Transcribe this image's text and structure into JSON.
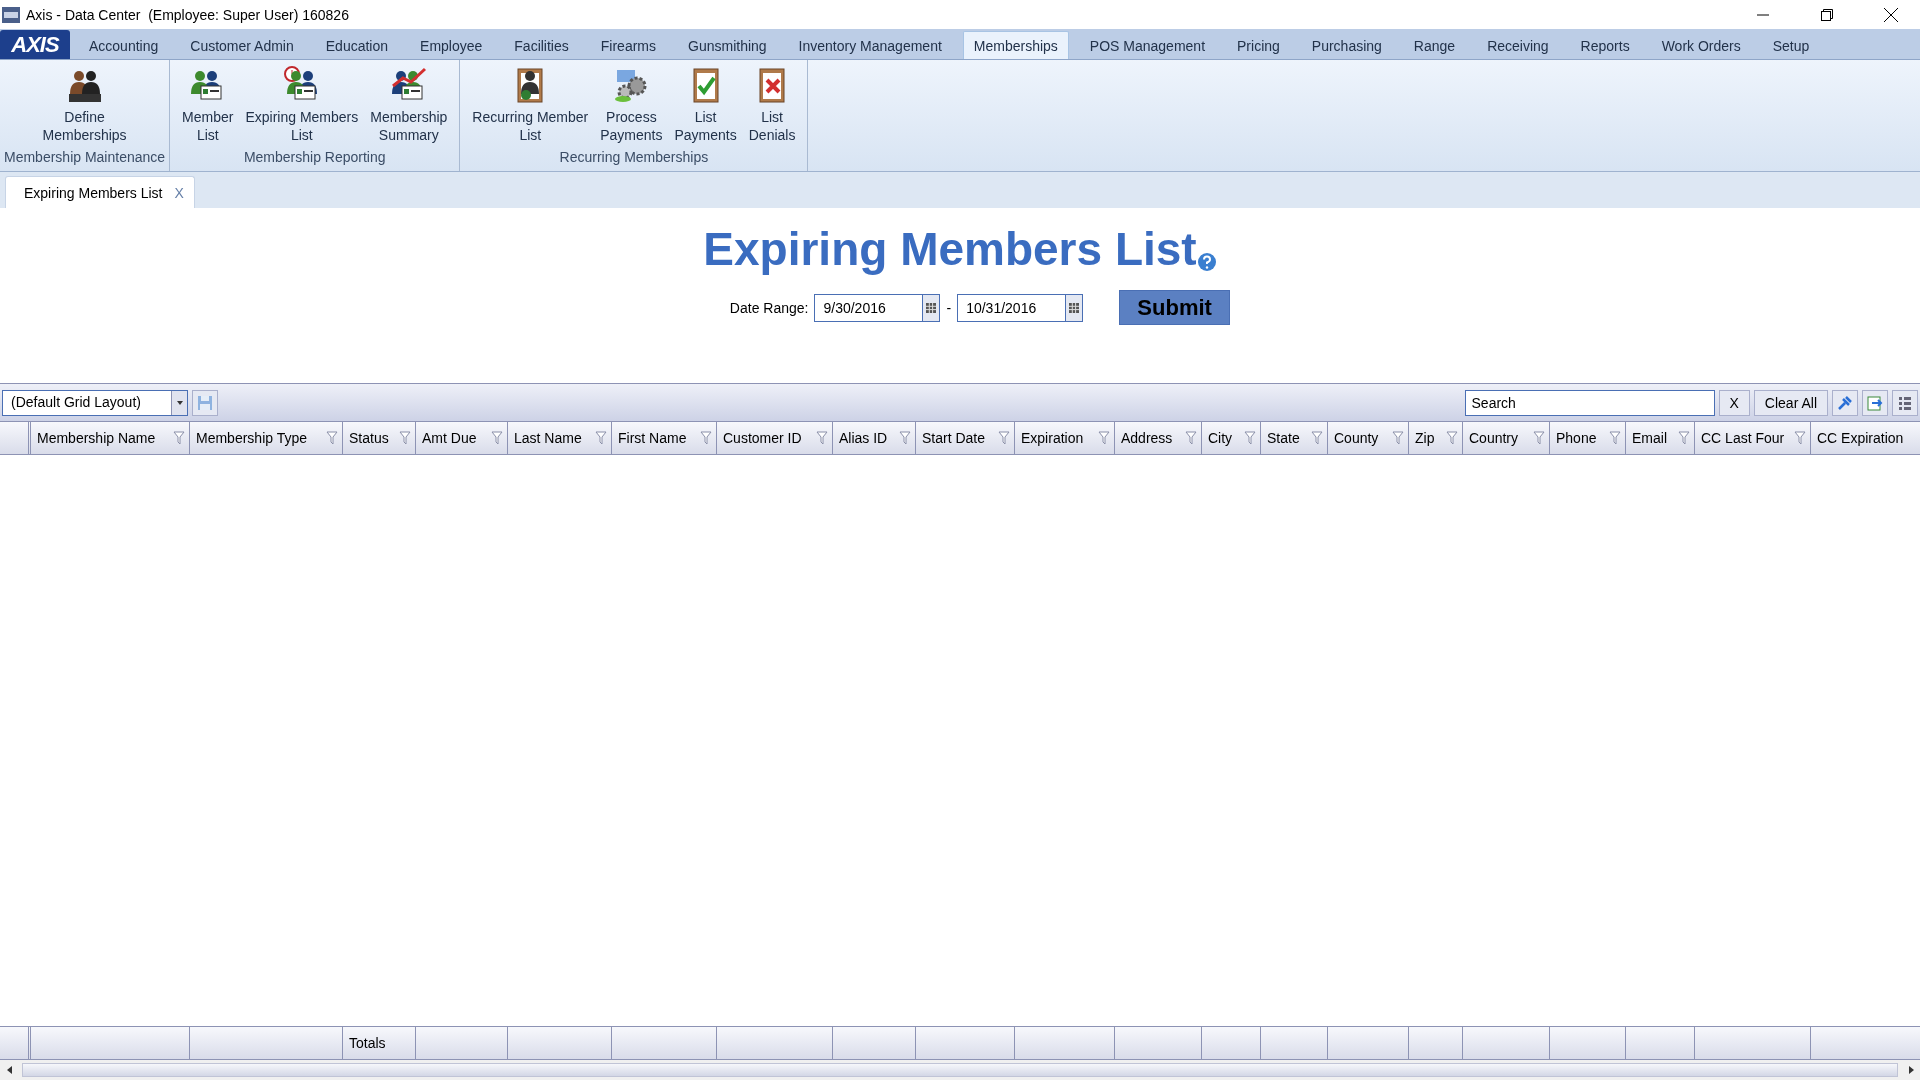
{
  "window": {
    "title": "Axis - Data Center  (Employee: Super User) 160826"
  },
  "logo": "AXIS",
  "menu": [
    {
      "label": "Accounting",
      "selected": false
    },
    {
      "label": "Customer Admin",
      "selected": false
    },
    {
      "label": "Education",
      "selected": false
    },
    {
      "label": "Employee",
      "selected": false
    },
    {
      "label": "Facilities",
      "selected": false
    },
    {
      "label": "Firearms",
      "selected": false
    },
    {
      "label": "Gunsmithing",
      "selected": false
    },
    {
      "label": "Inventory Management",
      "selected": false
    },
    {
      "label": "Memberships",
      "selected": true
    },
    {
      "label": "POS Management",
      "selected": false
    },
    {
      "label": "Pricing",
      "selected": false
    },
    {
      "label": "Purchasing",
      "selected": false
    },
    {
      "label": "Range",
      "selected": false
    },
    {
      "label": "Receiving",
      "selected": false
    },
    {
      "label": "Reports",
      "selected": false
    },
    {
      "label": "Work Orders",
      "selected": false
    },
    {
      "label": "Setup",
      "selected": false
    }
  ],
  "ribbon_groups": [
    {
      "title": "Membership Maintenance",
      "items": [
        {
          "label": "Define\nMemberships",
          "kind": "people"
        }
      ]
    },
    {
      "title": "Membership Reporting",
      "items": [
        {
          "label": "Member\nList",
          "kind": "card"
        },
        {
          "label": "Expiring Members\nList",
          "kind": "clock"
        },
        {
          "label": "Membership\nSummary",
          "kind": "chart"
        }
      ]
    },
    {
      "title": "Recurring Memberships",
      "items": [
        {
          "label": "Recurring Member\nList",
          "kind": "clipboard"
        },
        {
          "label": "Process\nPayments",
          "kind": "gears"
        },
        {
          "label": "List\nPayments",
          "kind": "check"
        },
        {
          "label": "List\nDenials",
          "kind": "cross"
        }
      ]
    }
  ],
  "doc_tabs": [
    {
      "label": "Expiring Members List",
      "close": "X",
      "selected": true
    }
  ],
  "page": {
    "heading": "Expiring Members List",
    "date_range_label": "Date Range:",
    "start_date": "9/30/2016",
    "separator": "-",
    "end_date": "10/31/2016",
    "submit": "Submit"
  },
  "grid_toolbar": {
    "layout": "(Default Grid Layout)",
    "search_placeholder": "Search",
    "clear_x": "X",
    "clear_all": "Clear All"
  },
  "table": {
    "columns": [
      "Membership Name",
      "Membership Type",
      "Status",
      "Amt Due",
      "Last Name",
      "First Name",
      "Customer ID",
      "Alias ID",
      "Start Date",
      "Expiration",
      "Address",
      "City",
      "State",
      "County",
      "Zip",
      "Country",
      "Phone",
      "Email",
      "CC Last Four",
      "CC Expiration"
    ],
    "totals_label": "Totals"
  }
}
